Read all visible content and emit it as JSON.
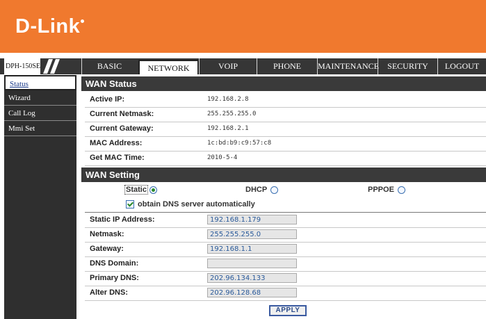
{
  "brand": {
    "logo": "D-Link"
  },
  "model": "DPH-150SE",
  "tabs": [
    {
      "label": "BASIC"
    },
    {
      "label": "NETWORK"
    },
    {
      "label": "VOIP"
    },
    {
      "label": "PHONE"
    },
    {
      "label": "MAINTENANCE"
    },
    {
      "label": "SECURITY"
    },
    {
      "label": "LOGOUT"
    }
  ],
  "active_tab": "NETWORK",
  "sidebar": {
    "items": [
      {
        "label": "Status"
      },
      {
        "label": "Wizard"
      },
      {
        "label": "Call Log"
      },
      {
        "label": "Mmi Set"
      }
    ],
    "active": "Status"
  },
  "wan_status": {
    "title": "WAN Status",
    "rows": [
      {
        "label": "Active IP:",
        "value": "192.168.2.8"
      },
      {
        "label": "Current Netmask:",
        "value": "255.255.255.0"
      },
      {
        "label": "Current Gateway:",
        "value": "192.168.2.1"
      },
      {
        "label": "MAC Address:",
        "value": "1c:bd:b9:c9:57:c8"
      },
      {
        "label": "Get MAC Time:",
        "value": "2010-5-4"
      }
    ]
  },
  "wan_setting": {
    "title": "WAN Setting",
    "modes": [
      {
        "label": "Static",
        "checked": true
      },
      {
        "label": "DHCP",
        "checked": false
      },
      {
        "label": "PPPOE",
        "checked": false
      }
    ],
    "dns_auto_label": "obtain DNS server automatically",
    "dns_auto_checked": true,
    "fields": [
      {
        "label": "Static IP Address:",
        "value": "192.168.1.179"
      },
      {
        "label": "Netmask:",
        "value": "255.255.255.0"
      },
      {
        "label": "Gateway:",
        "value": "192.168.1.1"
      },
      {
        "label": "DNS Domain:",
        "value": ""
      },
      {
        "label": "Primary DNS:",
        "value": "202.96.134.133"
      },
      {
        "label": "Alter DNS:",
        "value": "202.96.128.68"
      }
    ],
    "apply_label": "APPLY"
  },
  "colors": {
    "header": "#f0792e",
    "nav": "#363636",
    "sidebar": "#2f2f2f",
    "section_header": "#3a3a3a"
  }
}
